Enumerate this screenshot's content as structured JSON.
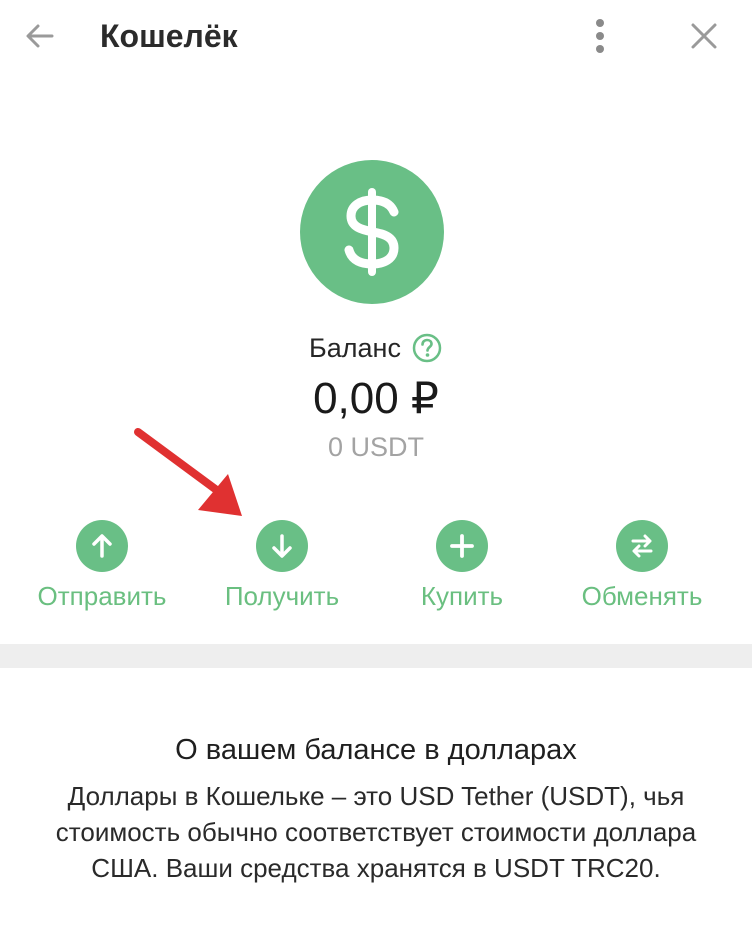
{
  "header": {
    "title": "Кошелёк",
    "back_icon": "arrow-left-icon",
    "more_icon": "kebab-menu-icon",
    "close_icon": "close-icon"
  },
  "wallet": {
    "coin_icon": "dollar-icon",
    "balance_label": "Баланс",
    "help_icon": "question-circle-icon",
    "balance_amount": "0,00 ₽",
    "balance_crypto": "0 USDT"
  },
  "actions": [
    {
      "label": "Отправить",
      "icon": "arrow-up-icon"
    },
    {
      "label": "Получить",
      "icon": "arrow-down-icon"
    },
    {
      "label": "Купить",
      "icon": "plus-icon"
    },
    {
      "label": "Обменять",
      "icon": "swap-arrows-icon"
    }
  ],
  "info": {
    "title": "О вашем балансе в долларах",
    "text": "Доллары в Кошельке – это USD Tether (USDT), чья стоимость обычно соответствует стоимости доллара США. Ваши средства хранятся в USDT TRC20."
  },
  "colors": {
    "accent": "#69bf86",
    "accent_text": "#6abf80",
    "annotation_arrow": "#e03131",
    "muted": "#a3a3a3"
  }
}
